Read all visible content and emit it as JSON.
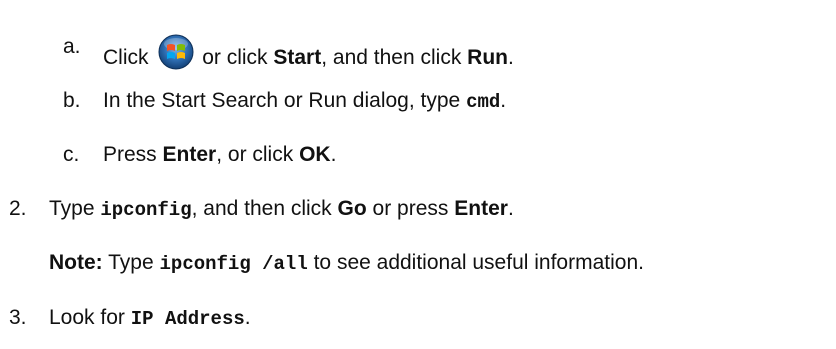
{
  "steps": {
    "a": {
      "marker": "a.",
      "t1": "Click",
      "icon": "windows-start-orb-icon",
      "t2": "or click",
      "b1": "Start",
      "t3": ", and then click",
      "b2": "Run",
      "t4": "."
    },
    "b": {
      "marker": "b.",
      "t1": "In the Start Search or Run dialog, type",
      "code": "cmd",
      "t2": "."
    },
    "c": {
      "marker": "c.",
      "t1": "Press",
      "b1": "Enter",
      "t2": ", or click",
      "b2": "OK",
      "t3": "."
    },
    "step2": {
      "marker": "2.",
      "t1": "Type",
      "code": "ipconfig",
      "t2": ", and then click",
      "b1": "Go",
      "t3": "or press",
      "b2": "Enter",
      "t4": "."
    },
    "note": {
      "label": "Note:",
      "t1": "Type",
      "code": "ipconfig /all",
      "t2": "to see additional useful information."
    },
    "step3": {
      "marker": "3.",
      "t1": "Look for",
      "code": "IP Address",
      "t2": "."
    }
  }
}
